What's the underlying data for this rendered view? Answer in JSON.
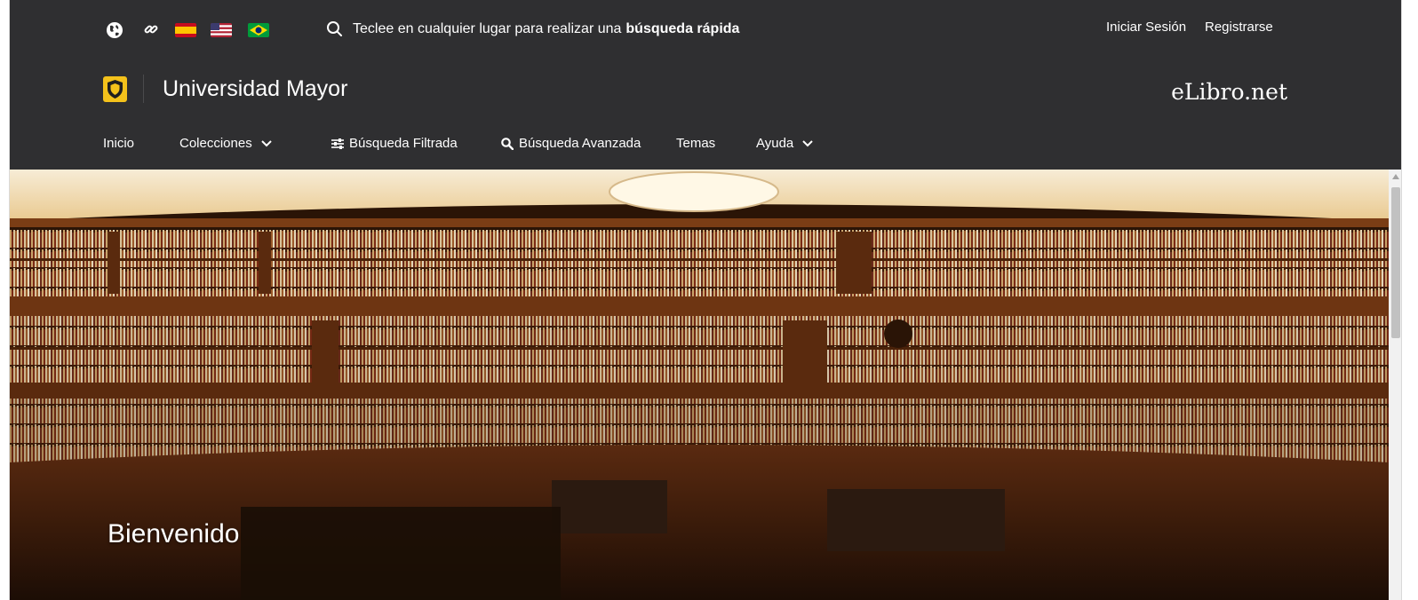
{
  "topbar": {
    "quick_search": {
      "text": "Teclee en cualquier lugar para realizar una",
      "bold": "búsqueda rápida"
    },
    "auth": {
      "login": "Iniciar Sesión",
      "register": "Registrarse"
    }
  },
  "brand": {
    "university": "Universidad Mayor",
    "platform": "eLibro.net"
  },
  "nav": {
    "items": [
      {
        "label": "Inicio"
      },
      {
        "label": "Colecciones"
      },
      {
        "label": "Búsqueda Filtrada"
      },
      {
        "label": "Búsqueda Avanzada"
      },
      {
        "label": "Temas"
      },
      {
        "label": "Ayuda"
      }
    ]
  },
  "hero": {
    "title": "Bienvenido"
  },
  "colors": {
    "topbar": "#2f2f31",
    "brand_logo": "#f4c21b",
    "text": "#ffffff"
  },
  "icons": {
    "globe": "globe-icon",
    "link": "link-icon",
    "flag_es": "spain-flag-icon",
    "flag_us": "usa-flag-icon",
    "flag_br": "brazil-flag-icon",
    "search": "search-icon",
    "filter": "sliders-icon",
    "magnifier": "magnifier-icon",
    "chevron": "chevron-down-icon",
    "shield": "shield-icon"
  }
}
